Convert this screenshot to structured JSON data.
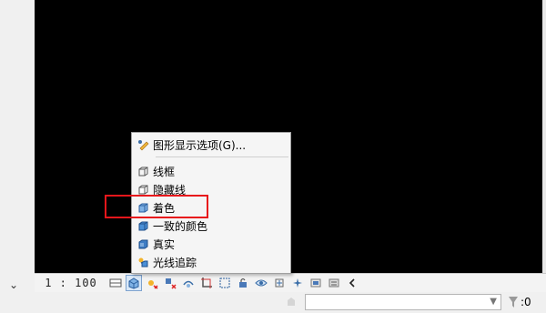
{
  "view_bar": {
    "scale": "1 : 100",
    "icons": [
      "detail-level-icon",
      "visual-style-icon",
      "sun-path-icon",
      "shadows-icon",
      "rendering-dialog-icon",
      "crop-view-icon",
      "crop-region-icon",
      "unlock-3d-view-icon",
      "temporary-hide-icon",
      "reveal-hidden-icon",
      "temporary-view-properties-icon",
      "analytical-model-icon",
      "highlight-displacement-icon",
      "reveal-constraints-icon"
    ]
  },
  "menu": {
    "graphic_options": "图形显示选项(G)...",
    "items": [
      {
        "label": "线框",
        "icon": "wireframe-icon"
      },
      {
        "label": "隐藏线",
        "icon": "hidden-line-icon"
      },
      {
        "label": "着色",
        "icon": "shaded-icon"
      },
      {
        "label": "一致的颜色",
        "icon": "consistent-colors-icon"
      },
      {
        "label": "真实",
        "icon": "realistic-icon"
      },
      {
        "label": "光线追踪",
        "icon": "ray-trace-icon"
      }
    ]
  },
  "status_bar": {
    "filter_count": ":0"
  },
  "colors": {
    "viewport": "#000000",
    "highlight": "#e8161b",
    "active_icon_bg": "#d9e8f8"
  }
}
